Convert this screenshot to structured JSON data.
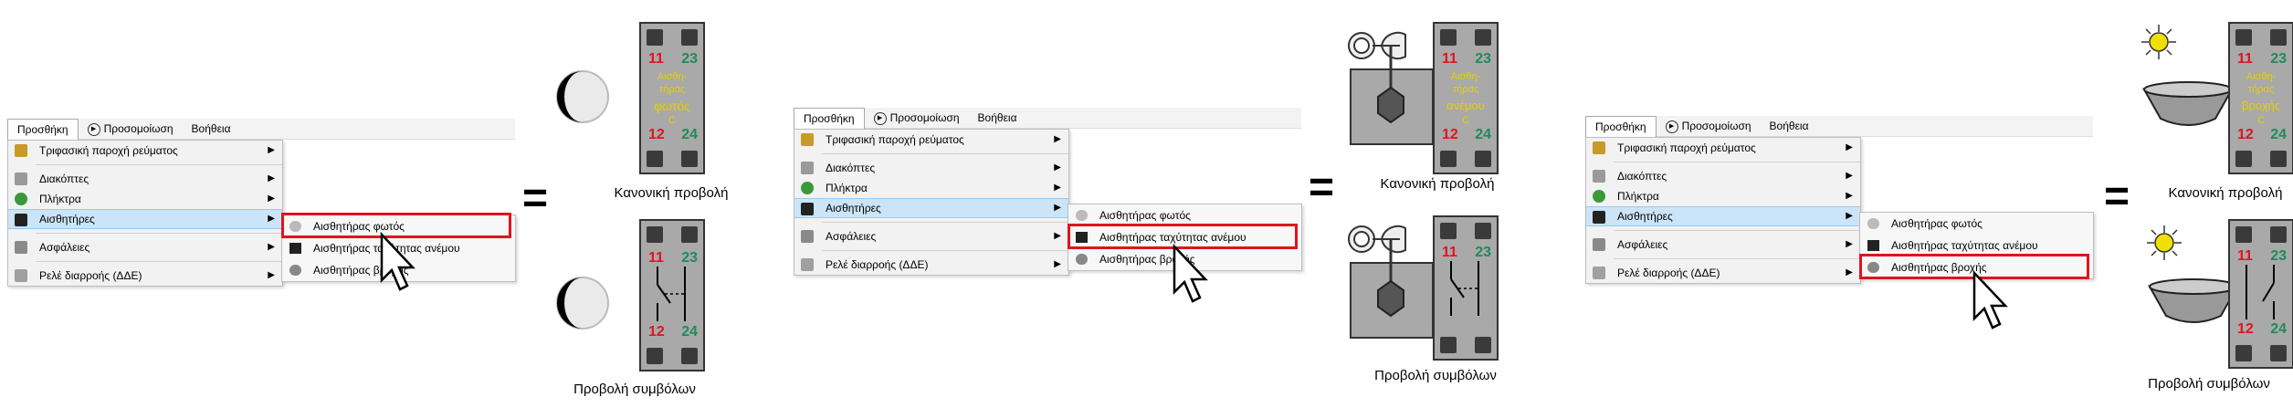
{
  "menubar": {
    "items": [
      "Προσθήκη",
      "Προσομοίωση",
      "Βοήθεια"
    ]
  },
  "dropdown": {
    "items": [
      {
        "label": "Τριφασική παροχή ρεύματος",
        "icon": "three-phase-icon"
      },
      {
        "label": "Διακόπτες",
        "icon": "switch-icon"
      },
      {
        "label": "Πλήκτρα",
        "icon": "button-icon"
      },
      {
        "label": "Αισθητήρες",
        "icon": "sensor-icon"
      },
      {
        "label": "Ασφάλειες",
        "icon": "fuse-icon"
      },
      {
        "label": "Ρελέ διαρροής (ΔΔΕ)",
        "icon": "rcd-icon"
      }
    ],
    "submenu": [
      {
        "label": "Αισθητήρας φωτός",
        "icon": "light-sensor-icon"
      },
      {
        "label": "Αισθητήρας ταχύτητας ανέμου",
        "icon": "wind-sensor-icon"
      },
      {
        "label": "Αισθητήρας βροχής",
        "icon": "rain-sensor-icon"
      }
    ]
  },
  "panels": [
    {
      "selected_submenu_index": 0,
      "device_text": [
        "Αισθη-",
        "τήρας",
        "φωτός",
        "C"
      ]
    },
    {
      "selected_submenu_index": 1,
      "device_text": [
        "Αισθη-",
        "τήρας",
        "ανέμου",
        "C"
      ]
    },
    {
      "selected_submenu_index": 2,
      "device_text": [
        "Αισθη-",
        "τήρας",
        "βροχής",
        "C"
      ]
    }
  ],
  "symbols": {
    "equals": "=",
    "terminal_top_left": "11",
    "terminal_top_right": "23",
    "terminal_bottom_left": "12",
    "terminal_bottom_right": "24"
  },
  "captions": {
    "normal_view": "Κανονική προβολή",
    "symbol_view": "Προβολή συμβόλων"
  },
  "colors": {
    "highlight_box": "#e0141e",
    "terminal_red": "#e0141e",
    "terminal_green": "#1f8a5a",
    "device_label": "#e6d000",
    "menu_highlight": "#cce4f7"
  }
}
